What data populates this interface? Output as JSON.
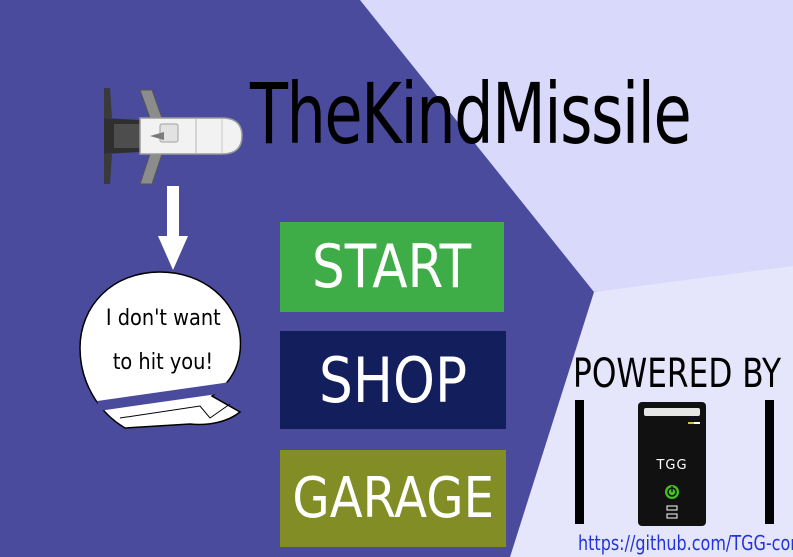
{
  "title": "TheKindMissile",
  "speech_bubble": {
    "line1": "I don't want",
    "line2": "to hit you!"
  },
  "menu": {
    "start_label": "START",
    "shop_label": "SHOP",
    "garage_label": "GARAGE"
  },
  "powered": {
    "text": "POWERED BY",
    "logo_text": "TGG",
    "link_text": "https://github.com/TGG-com"
  },
  "colors": {
    "background_dark": "#4a4b9d",
    "background_light": "#d9d9fb",
    "background_lighter": "#e5e5fb",
    "start": "#3fad47",
    "shop": "#131f5c",
    "garage": "#828d25",
    "link": "#2233dd"
  },
  "icons": [
    "missile-icon",
    "down-arrow-icon",
    "speech-bubble",
    "tgg-computer-icon",
    "power-icon"
  ]
}
